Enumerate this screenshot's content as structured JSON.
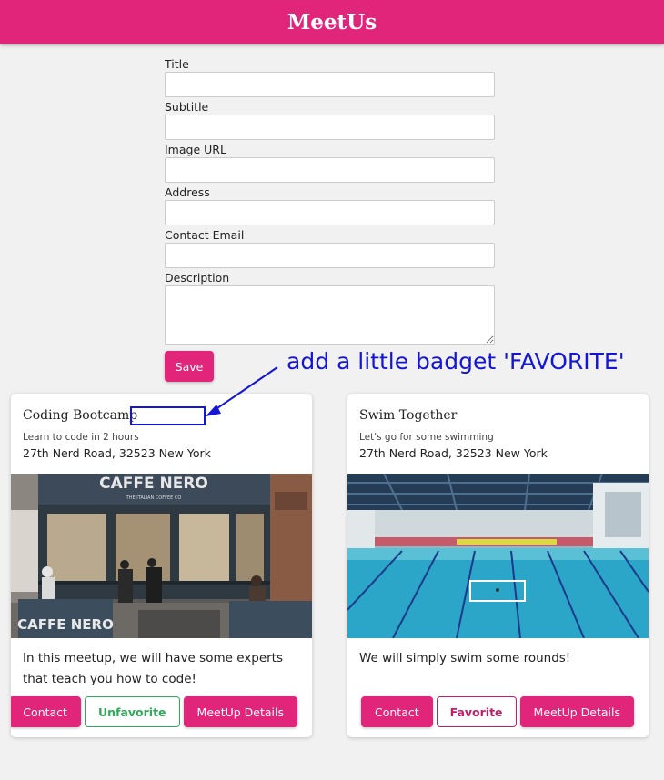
{
  "app": {
    "title": "MeetUs"
  },
  "form": {
    "fields": [
      {
        "label": "Title",
        "value": ""
      },
      {
        "label": "Subtitle",
        "value": ""
      },
      {
        "label": "Image URL",
        "value": ""
      },
      {
        "label": "Address",
        "value": ""
      },
      {
        "label": "Contact Email",
        "value": ""
      }
    ],
    "description_label": "Description",
    "description_value": "",
    "save_label": "Save"
  },
  "annotation": {
    "text": "add a little badget 'FAVORITE'",
    "color": "#1515d6"
  },
  "meetups": [
    {
      "title": "Coding Bootcamp",
      "subtitle": "Learn to code in 2 hours",
      "address": "27th Nerd Road, 32523 New York",
      "image_signage": "CAFFE NERO",
      "image_tagline": "THE ITALIAN COFFEE CO",
      "image_awning": "CAFFE NERO",
      "description": "In this meetup, we will have some experts that teach you how to code!",
      "contact_label": "Contact",
      "favorite_label": "Unfavorite",
      "details_label": "MeetUp Details"
    },
    {
      "title": "Swim Together",
      "subtitle": "Let's go for some swimming",
      "address": "27th Nerd Road, 32523 New York",
      "description": "We will simply swim some rounds!",
      "contact_label": "Contact",
      "favorite_label": "Favorite",
      "details_label": "MeetUp Details"
    }
  ],
  "colors": {
    "brand": "#e0257a",
    "favorite_green": "#2eab5a",
    "favorite_pink": "#c21c66",
    "background": "#f1f1f1"
  }
}
